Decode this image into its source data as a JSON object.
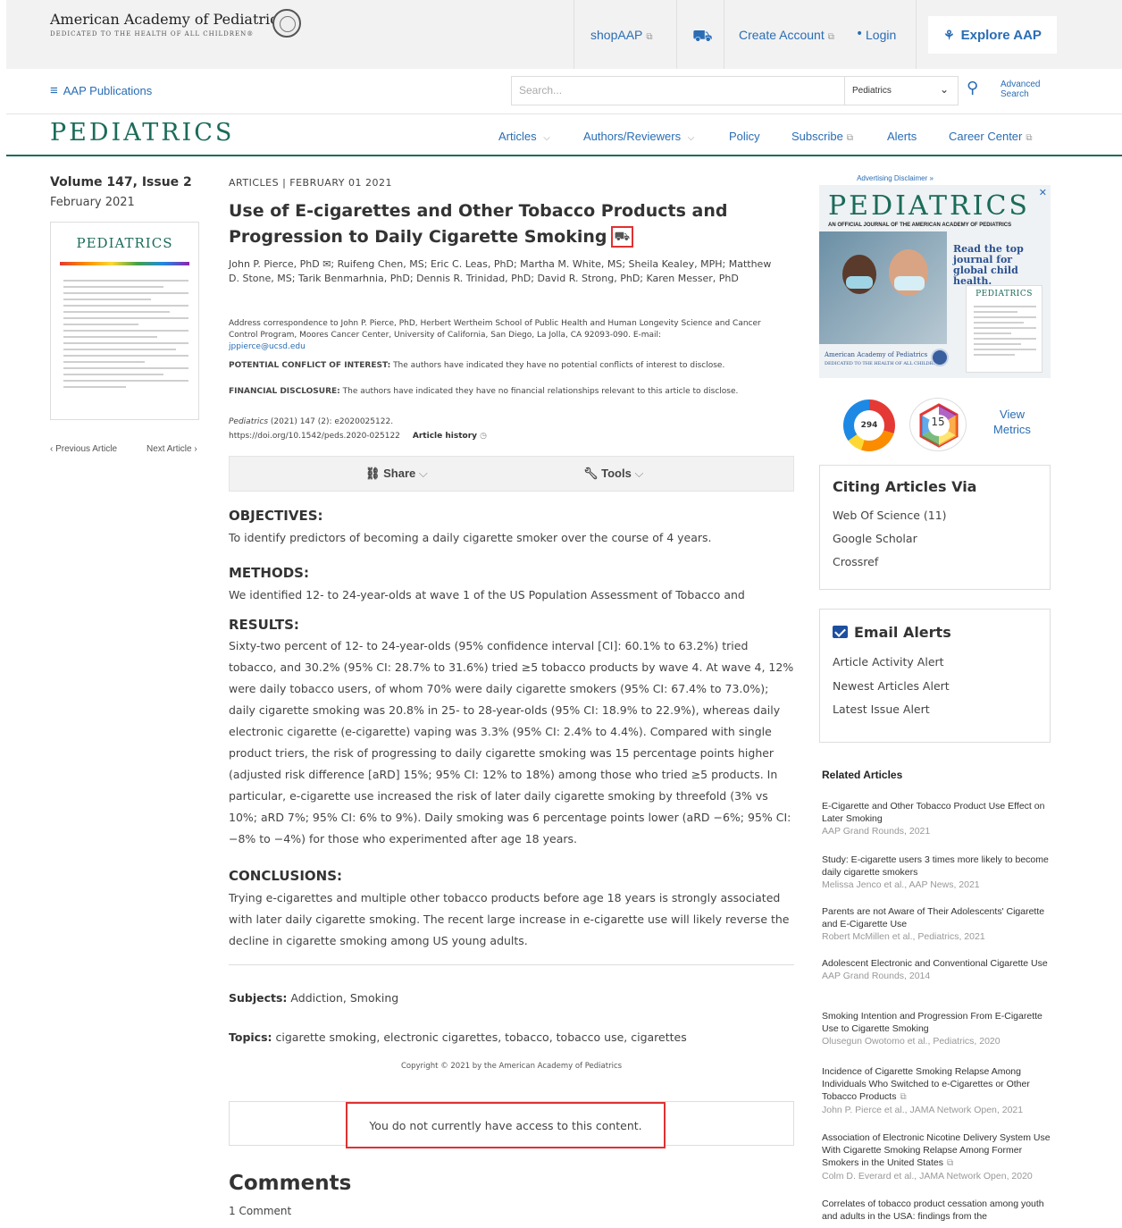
{
  "brand": {
    "org_name": "American Academy of Pediatrics",
    "org_tagline": "DEDICATED TO THE HEALTH OF ALL CHILDREN®"
  },
  "topbar": {
    "shop": "shopAAP",
    "create_account": "Create Account",
    "separator": "•",
    "login": "Login",
    "explore": "Explore AAP"
  },
  "subnav": {
    "publications": "AAP Publications",
    "search_placeholder": "Search...",
    "search_scope": "Pediatrics",
    "advanced_line1": "Advanced",
    "advanced_line2": "Search"
  },
  "journal": {
    "title": "PEDIATRICS",
    "nav": [
      {
        "label": "Articles",
        "suffix": "⌵"
      },
      {
        "label": "Authors/Reviewers",
        "suffix": "⌵"
      },
      {
        "label": "Policy",
        "suffix": ""
      },
      {
        "label": "Subscribe",
        "suffix": "⧉"
      },
      {
        "label": "Alerts",
        "suffix": ""
      },
      {
        "label": "Career Center",
        "suffix": "⧉"
      }
    ]
  },
  "issue": {
    "volume": "Volume 147, Issue 2",
    "date": "February 2021",
    "cover_title": "PEDIATRICS",
    "prev": "‹  Previous Article",
    "next": "Next Article  ›"
  },
  "article": {
    "kicker": "ARTICLES  |  FEBRUARY 01 2021",
    "title": "Use of E-cigarettes and Other Tobacco Products and Progression to Daily Cigarette Smoking",
    "authors": "John P. Pierce, PhD ✉; Ruifeng Chen, MS; Eric C. Leas, PhD; Martha M. White, MS; Sheila Kealey, MPH; Matthew D. Stone, MS; Tarik Benmarhnia, PhD; Dennis R. Trinidad, PhD; David R. Strong, PhD; Karen Messer, PhD",
    "correspondence": "Address correspondence to John P. Pierce, PhD, Herbert Wertheim School of Public Health and Human Longevity Science and Cancer Control Program, Moores Cancer Center, University of California, San Diego, La Jolla, CA 92093-090. E-mail:",
    "email": "jppierce@ucsd.edu",
    "coi_label": "POTENTIAL CONFLICT OF INTEREST:",
    "coi_text": " The authors have indicated they have no potential conflicts of interest to disclose.",
    "fin_label": "FINANCIAL DISCLOSURE:",
    "fin_text": " The authors have indicated they have no financial relationships relevant to this article to disclose.",
    "citation_journal": "Pediatrics",
    "citation_rest": " (2021) 147 (2): e2020025122.",
    "doi": "https://doi.org/10.1542/peds.2020-025122",
    "history": "Article history",
    "share": "Share",
    "tools": "Tools",
    "objectives_h": "OBJECTIVES:",
    "objectives": "To identify predictors of becoming a daily cigarette smoker over the course of 4 years.",
    "methods_h": "METHODS:",
    "methods": "We identified 12- to 24-year-olds at wave 1 of the US Population Assessment of Tobacco and",
    "results_h": "RESULTS:",
    "results": "Sixty-two percent of 12- to 24-year-olds (95% confidence interval [CI]: 60.1% to 63.2%) tried tobacco, and 30.2% (95% CI: 28.7% to 31.6%) tried ≥5 tobacco products by wave 4. At wave 4, 12% were daily tobacco users, of whom 70% were daily cigarette smokers (95% CI: 67.4% to 73.0%); daily cigarette smoking was 20.8% in 25- to 28-year-olds (95% CI: 18.9% to 22.9%), whereas daily electronic cigarette (e-cigarette) vaping was 3.3% (95% CI: 2.4% to 4.4%). Compared with single product triers, the risk of progressing to daily cigarette smoking was 15 percentage points higher (adjusted risk difference [aRD] 15%; 95% CI: 12% to 18%) among those who tried ≥5 products. In particular, e-cigarette use increased the risk of later daily cigarette smoking by threefold (3% vs 10%; aRD 7%; 95% CI: 6% to 9%). Daily smoking was 6 percentage points lower (aRD −6%; 95% CI: −8% to −4%) for those who experimented after age 18 years.",
    "conclusions_h": "CONCLUSIONS:",
    "conclusions": "Trying e-cigarettes and multiple other tobacco products before age 18 years is strongly associated with later daily cigarette smoking. The recent large increase in e-cigarette use will likely reverse the decline in cigarette smoking among US young adults.",
    "subjects_label": "Subjects:",
    "subjects": "Addiction, Smoking",
    "topics_label": "Topics:",
    "topics": "cigarette smoking, electronic cigarettes, tobacco, tobacco use, cigarettes",
    "copyright": "Copyright © 2021 by the American Academy of Pediatrics",
    "access_msg": "You do not currently have access to this content.",
    "comments_h": "Comments",
    "comments_count": "1 Comment"
  },
  "sidebar": {
    "ad_disclaimer": "Advertising Disclaimer »",
    "ad": {
      "title": "PEDIATRICS",
      "subtitle": "AN OFFICIAL JOURNAL OF THE AMERICAN ACADEMY OF PEDIATRICS",
      "tagline": "Read the top journal for global child health.",
      "mini_title": "PEDIATRICS",
      "org": "American Academy of Pediatrics",
      "org_tag": "DEDICATED TO THE HEALTH OF ALL CHILDREN"
    },
    "altmetric": "294",
    "dimensions": "15",
    "view_metrics": "View Metrics",
    "citing_h": "Citing Articles Via",
    "citing": [
      "Web Of Science (11)",
      "Google Scholar",
      "Crossref"
    ],
    "alerts_h": "Email Alerts",
    "alerts": [
      "Article Activity Alert",
      "Newest Articles Alert",
      "Latest Issue Alert"
    ],
    "related_h": "Related Articles",
    "related": [
      {
        "title": "E-Cigarette and Other Tobacco Product Use Effect on Later Smoking",
        "src": "AAP Grand Rounds, 2021"
      },
      {
        "title": "Study: E-cigarette users 3 times more likely to become daily cigarette smokers",
        "src": "Melissa Jenco et al., AAP News, 2021"
      },
      {
        "title": "Parents are not Aware of Their Adolescents' Cigarette and E-Cigarette Use",
        "src": "Robert McMillen et al., Pediatrics, 2021"
      },
      {
        "title": "Adolescent Electronic and Conventional Cigarette Use",
        "src": "AAP Grand Rounds, 2014"
      },
      {
        "title": "Smoking Intention and Progression From E-Cigarette Use to Cigarette Smoking",
        "src": "Olusegun Owotomo et al., Pediatrics, 2020"
      },
      {
        "title": "Incidence of Cigarette Smoking Relapse Among Individuals Who Switched to e-Cigarettes or Other Tobacco Products",
        "src": "John P. Pierce et al., JAMA Network Open, 2021"
      },
      {
        "title": "Association of Electronic Nicotine Delivery System Use With Cigarette Smoking Relapse Among Former Smokers in the United States",
        "src": "Colm D. Everard et al., JAMA Network Open, 2020"
      },
      {
        "title": "Correlates of tobacco product cessation among youth and adults in the USA: findings from the",
        "src": ""
      }
    ]
  }
}
